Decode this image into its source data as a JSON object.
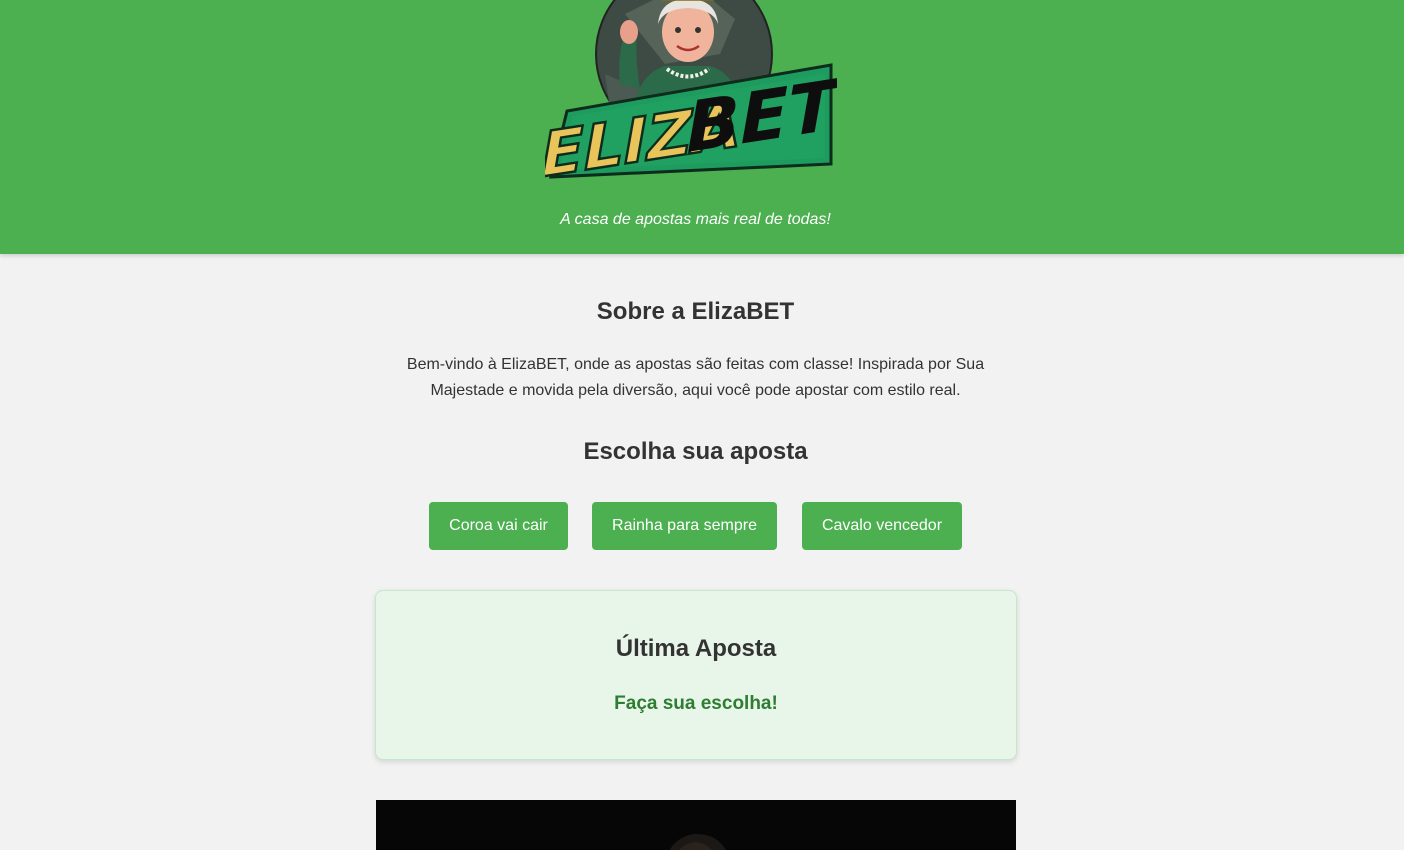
{
  "brand": {
    "logo_text_part1": "ELIZA",
    "logo_text_part2": "BET",
    "tagline": "A casa de apostas mais real de todas!"
  },
  "about": {
    "title": "Sobre a ElizaBET",
    "text": "Bem-vindo à ElizaBET, onde as apostas são feitas com classe! Inspirada por Sua Majestade e movida pela diversão, aqui você pode apostar com estilo real."
  },
  "bets": {
    "title": "Escolha sua aposta",
    "options": [
      "Coroa vai cair",
      "Rainha para sempre",
      "Cavalo vencedor"
    ]
  },
  "last_bet": {
    "title": "Última Aposta",
    "result": "Faça sua escolha!"
  },
  "colors": {
    "primary": "#4caf50",
    "page_background": "#f2f2f2",
    "result_text": "#2e7d32",
    "card_background": "#e8f5e9",
    "logo_yellow": "#e8c45a",
    "logo_banner": "#1e9b5e"
  }
}
